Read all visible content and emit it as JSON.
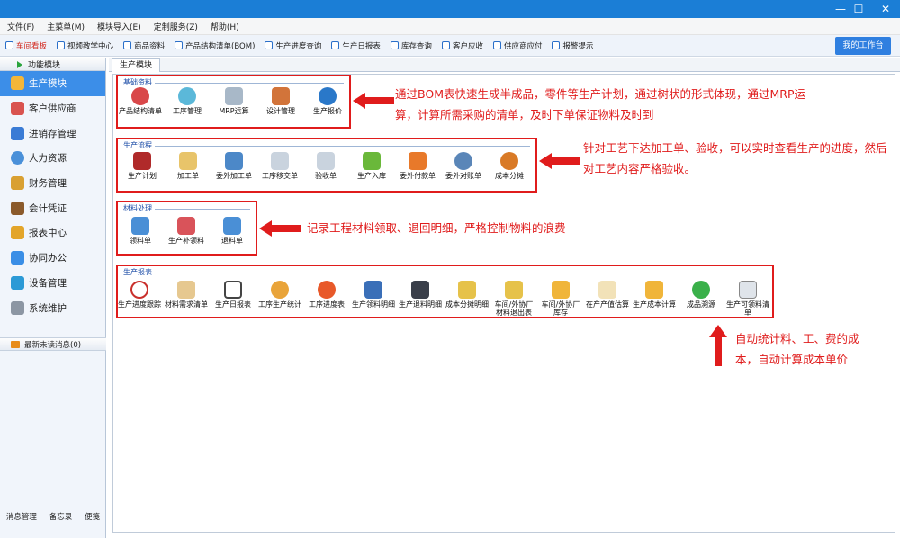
{
  "window": {
    "controls": [
      "—",
      "☐",
      "✕"
    ]
  },
  "menu": [
    "文件(F)",
    "主菜单(M)",
    "模块导入(E)",
    "定制服务(Z)",
    "帮助(H)"
  ],
  "toolbar": {
    "items": [
      "车间看板",
      "视频教学中心",
      "商品资料",
      "产品结构清单(BOM)",
      "生产进度查询",
      "生产日报表",
      "库存查询",
      "客户应收",
      "供应商应付",
      "报警提示"
    ],
    "workbench": "我的工作台"
  },
  "sidebar": {
    "header": "功能模块",
    "items": [
      "生产模块",
      "客户供应商",
      "进销存管理",
      "人力资源",
      "财务管理",
      "会计凭证",
      "报表中心",
      "协同办公",
      "设备管理",
      "系统维护"
    ],
    "message": "最新未读消息(0)",
    "bottom": [
      "消息管理",
      "备忘录",
      "便笺"
    ]
  },
  "main": {
    "tab": "生产模块",
    "groups": [
      {
        "title": "基础资料",
        "items": [
          "产品结构清单",
          "工序管理",
          "MRP运算",
          "设计管理",
          "生产报价"
        ]
      },
      {
        "title": "生产流程",
        "items": [
          "生产计划",
          "加工单",
          "委外加工单",
          "工序移交单",
          "验收单",
          "生产入库",
          "委外付款单",
          "委外对账单",
          "成本分摊"
        ]
      },
      {
        "title": "材料处理",
        "items": [
          "领料单",
          "生产补领料",
          "退料单"
        ]
      },
      {
        "title": "生产报表",
        "items": [
          "生产进度跟踪",
          "材料需求清单",
          "生产日报表",
          "工序生产统计",
          "工序进度表",
          "生产领料明细",
          "生产退料明细",
          "成本分摊明细",
          "车间/外协厂材料退出表",
          "车间/外协厂库存",
          "在产产值估算",
          "生产成本计算",
          "成品溯源",
          "生产可领料清单"
        ]
      }
    ],
    "notes": [
      "通过BOM表快速生成半成品，零件等生产计划，通过树状的形式体现，通过MRP运算，计算所需采购的清单，及时下单保证物料及时到",
      "针对工艺下达加工单、验收，可以实时查看生产的进度，然后对工艺内容严格验收。",
      "记录工程材料领取、退回明细，严格控制物料的浪费",
      "自动统计料、工、费的成本，自动计算成本单价"
    ]
  }
}
